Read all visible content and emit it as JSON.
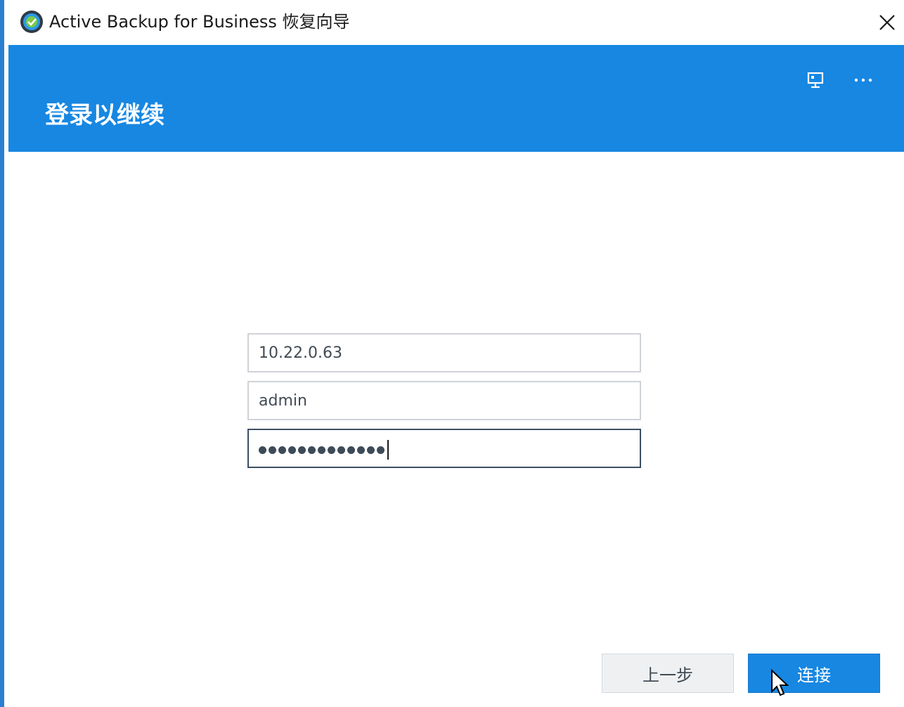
{
  "window": {
    "title": "Active Backup for Business 恢复向导"
  },
  "header": {
    "title": "登录以继续",
    "icons": [
      "monitor-network-icon",
      "more-options-icon"
    ]
  },
  "form": {
    "server_value": "10.22.0.63",
    "username_value": "admin",
    "password_length": 13
  },
  "buttons": {
    "prev_label": "上一步",
    "connect_label": "连接"
  },
  "colors": {
    "accent": "#1787e2",
    "focus_border": "#3c4e63",
    "input_border": "#cfd3d8"
  }
}
